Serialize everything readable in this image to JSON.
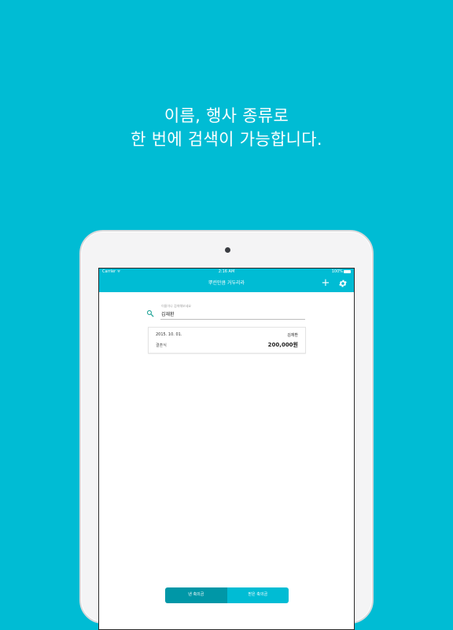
{
  "promo": {
    "line1": "이름, 행사 종류로",
    "line2": "한 번에 검색이 가능합니다."
  },
  "status_bar": {
    "carrier": "Carrier ᯤ",
    "time": "2:16 AM",
    "battery": "100%"
  },
  "app_bar": {
    "title": "뿌린만큼 거두리라",
    "add_icon": "plus-icon",
    "settings_icon": "gear-icon"
  },
  "search": {
    "hint": "이름이나 검색해보세요",
    "value": "김재환",
    "icon": "search-icon"
  },
  "results": [
    {
      "date": "2015. 10. 01.",
      "name": "김재환",
      "event": "결혼식",
      "amount": "200,000원"
    }
  ],
  "tabs": [
    {
      "label": "낸 축의금",
      "active": true
    },
    {
      "label": "받은 축의금",
      "active": false
    }
  ],
  "colors": {
    "background": "#00BCD4",
    "accent": "#00BCD4",
    "accent_dark": "#0097A7",
    "search_icon": "#26A69A"
  }
}
